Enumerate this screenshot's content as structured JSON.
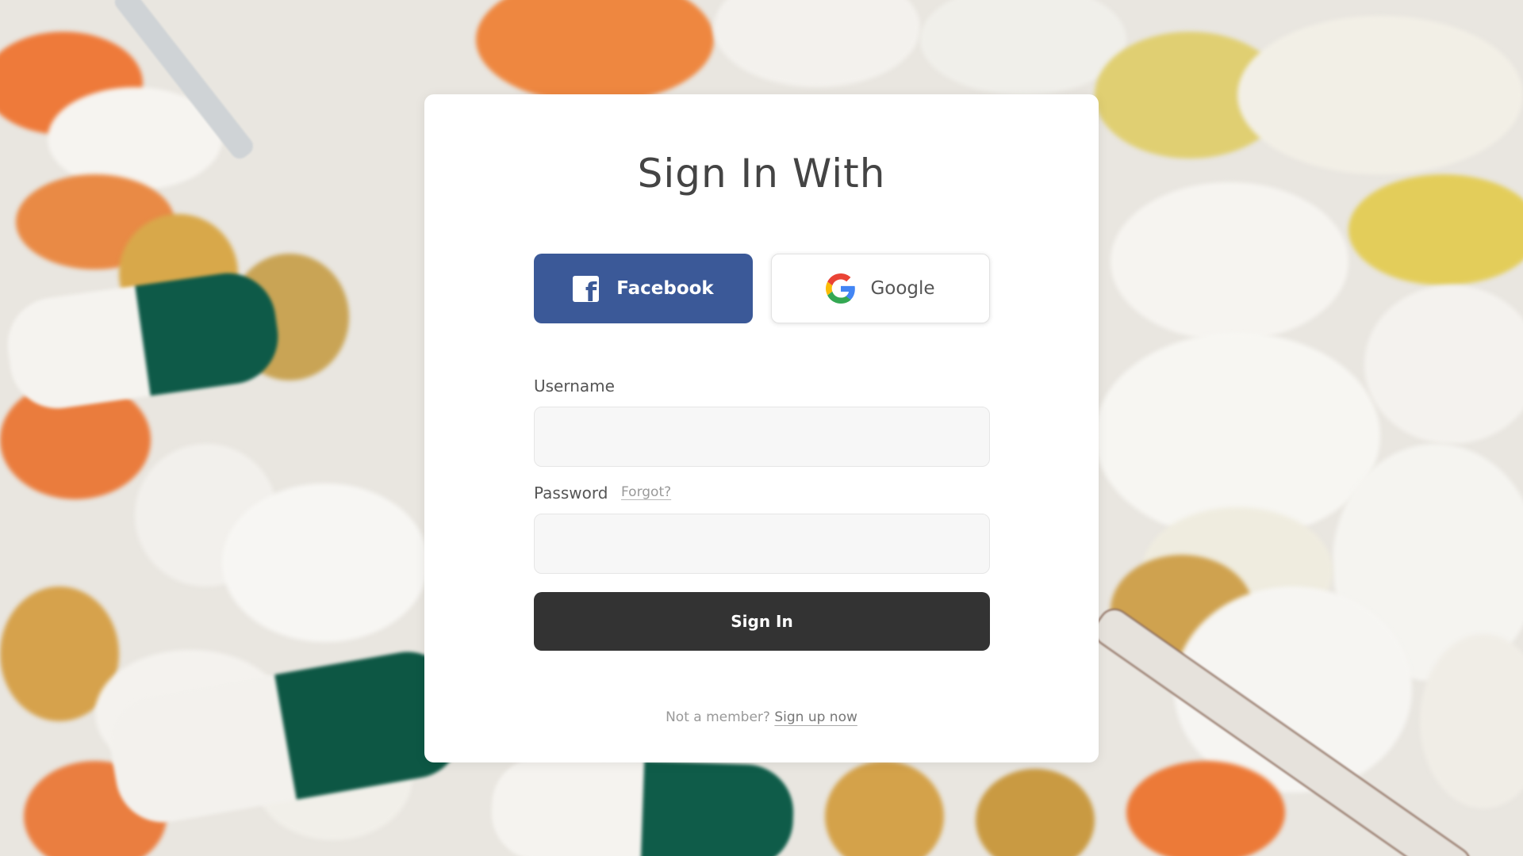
{
  "form": {
    "title": "Sign In With",
    "social": {
      "facebook_label": "Facebook",
      "google_label": "Google",
      "facebook_color": "#3b5998"
    },
    "username": {
      "label": "Username",
      "value": "",
      "placeholder": ""
    },
    "password": {
      "label": "Password",
      "forgot_label": "Forgot?",
      "value": "",
      "placeholder": ""
    },
    "submit_label": "Sign In",
    "submit_color": "#333333",
    "footer": {
      "prompt": "Not a member?",
      "signup_label": "Sign up now"
    }
  },
  "icons": {
    "facebook": "facebook-icon",
    "google": "google-icon"
  }
}
